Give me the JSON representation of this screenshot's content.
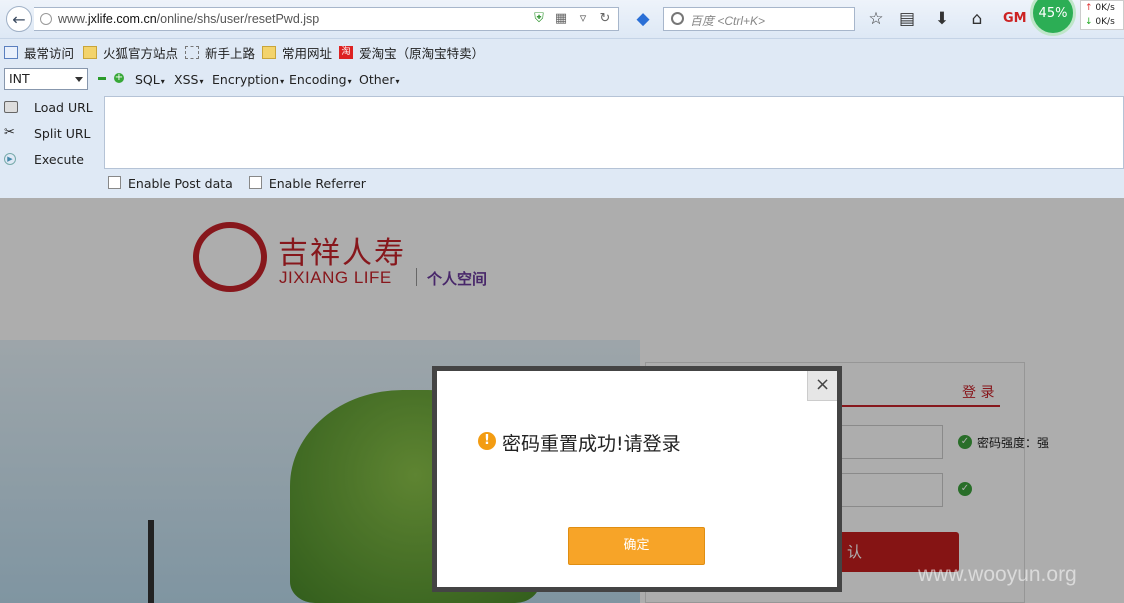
{
  "browser": {
    "url_prefix": "www.",
    "url_domain": "jxlife.com.cn",
    "url_path": "/online/shs/user/resetPwd.jsp",
    "search_placeholder": "百度 <Ctrl+K>",
    "memory_percent": "45%",
    "net_up": "0K/s",
    "net_down": "0K/s"
  },
  "bookmarks": [
    {
      "label": "最常访问",
      "icon": "blue"
    },
    {
      "label": "火狐官方站点",
      "icon": "folder"
    },
    {
      "label": "新手上路",
      "icon": "dash"
    },
    {
      "label": "常用网址",
      "icon": "folder"
    },
    {
      "label": "爱淘宝（原淘宝特卖）",
      "icon": "red"
    }
  ],
  "hackbar": {
    "select_value": "INT",
    "menus": [
      "SQL",
      "XSS",
      "Encryption",
      "Encoding",
      "Other"
    ],
    "actions": [
      "Load URL",
      "Split URL",
      "Execute"
    ],
    "options": [
      "Enable Post data",
      "Enable Referrer"
    ]
  },
  "site": {
    "logo_cn": "吉祥人寿",
    "logo_en": "JIXIANG LIFE",
    "section": "个人空间",
    "login_tab": "登 录",
    "strength_label": "密码强度：强",
    "confirm_partial": "认",
    "watermark": "www.wooyun.org"
  },
  "dialog": {
    "message": "密码重置成功!请登录",
    "ok_label": "确定",
    "close_glyph": "×",
    "warn_glyph": "!"
  },
  "colors": {
    "accent_red": "#c8222a",
    "dialog_button": "#f7a428",
    "success_green": "#3da33d"
  }
}
